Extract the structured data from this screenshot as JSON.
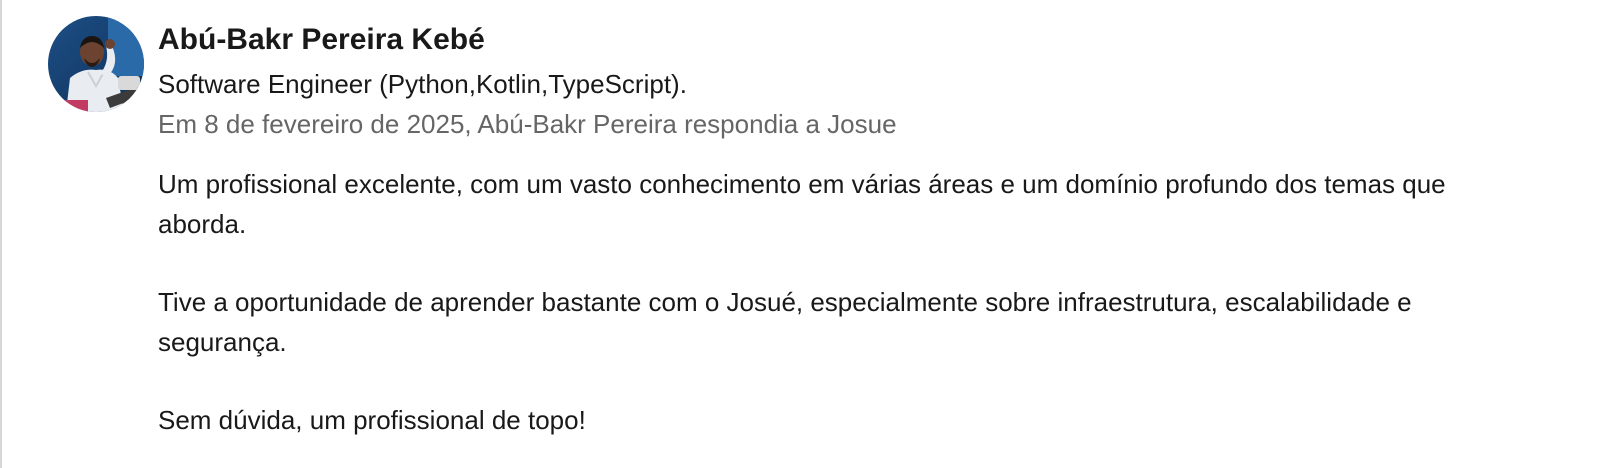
{
  "recommendation": {
    "author_name": "Abú-Bakr Pereira Kebé",
    "author_headline": "Software Engineer (Python,Kotlin,TypeScript).",
    "meta": "Em 8 de fevereiro de 2025, Abú-Bakr Pereira respondia a Josue",
    "avatar_icon": "profile-photo",
    "paragraphs": [
      "Um profissional excelente, com um vasto conhecimento em várias áreas e um domínio profundo dos temas que aborda.",
      "Tive a oportunidade de aprender bastante com o Josué, especialmente sobre infraestrutura, escalabilidade e segurança.",
      "Sem dúvida, um profissional de topo!"
    ]
  },
  "colors": {
    "text_primary": "#191919",
    "text_secondary": "#666666",
    "divider": "#d6d6d6"
  }
}
